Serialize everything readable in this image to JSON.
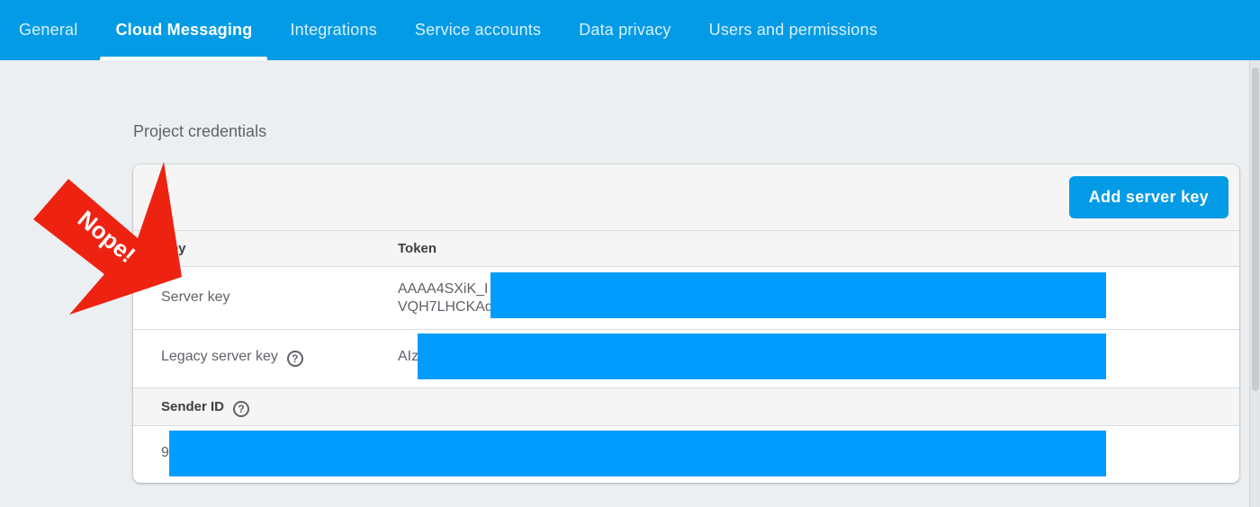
{
  "tabs": [
    {
      "label": "General"
    },
    {
      "label": "Cloud Messaging"
    },
    {
      "label": "Integrations"
    },
    {
      "label": "Service accounts"
    },
    {
      "label": "Data privacy"
    },
    {
      "label": "Users and permissions"
    }
  ],
  "section": {
    "title": "Project credentials"
  },
  "card": {
    "add_button_label": "Add server key",
    "columns": {
      "key": "Key",
      "token": "Token"
    },
    "rows": [
      {
        "key": "Server key",
        "token_line1": "AAAA4SXiK_I",
        "token_line2": "VQH7LHCKAd"
      },
      {
        "key": "Legacy server key",
        "token": "AIz"
      }
    ],
    "sender": {
      "label": "Sender ID",
      "value": "9"
    }
  },
  "annotation": {
    "text": "Nope!"
  },
  "colors": {
    "topbar": "#039be5",
    "button": "#039be5",
    "redaction": "#029cfe",
    "arrow": "#ee2211"
  },
  "icons": {
    "help": "help-circle-icon"
  }
}
